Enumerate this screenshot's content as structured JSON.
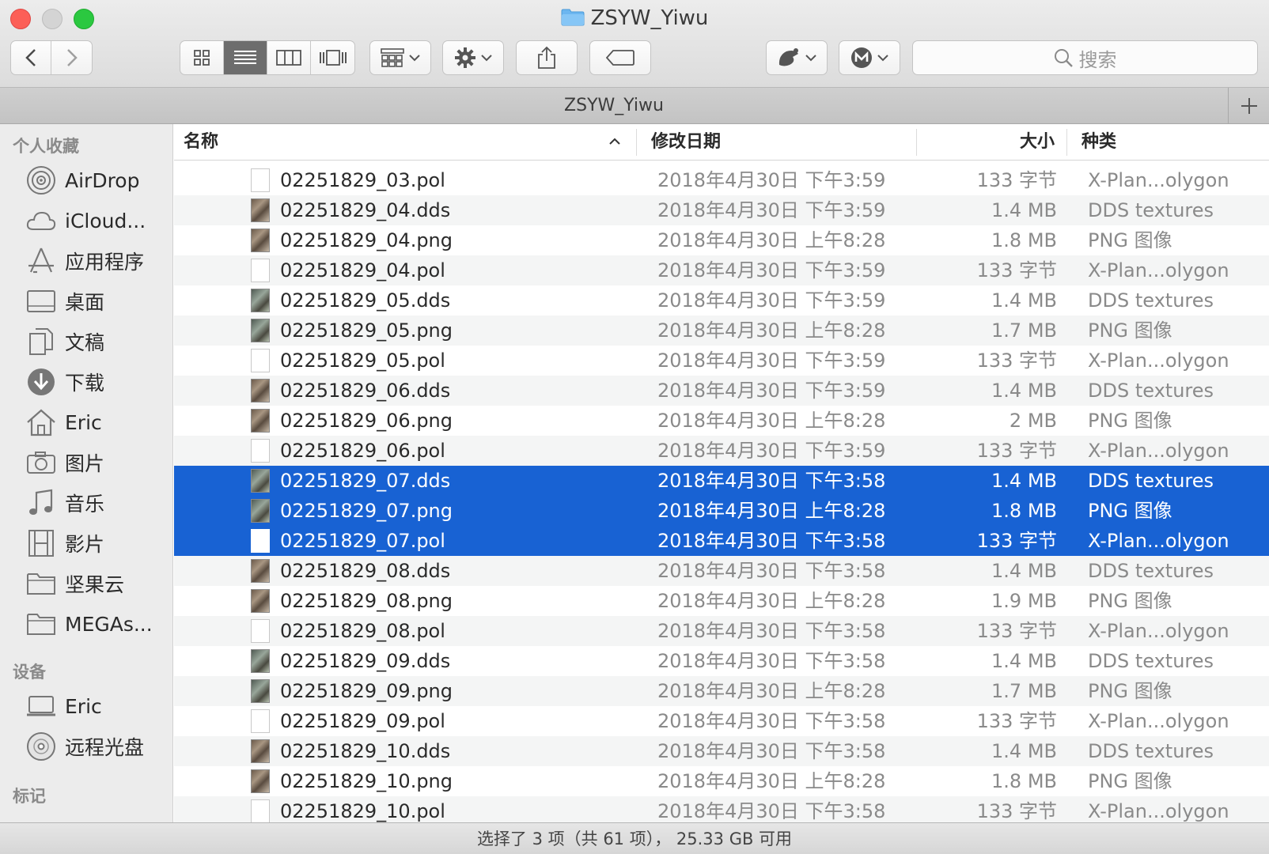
{
  "window": {
    "title": "ZSYW_Yiwu"
  },
  "toolbar": {
    "search_placeholder": "搜索",
    "icons": [
      "back-icon",
      "forward-icon",
      "icon-view-icon",
      "list-view-icon",
      "column-view-icon",
      "coverflow-view-icon",
      "arrange-icon",
      "gear-icon",
      "share-icon",
      "tag-icon",
      "app-extension-icon",
      "mega-icon",
      "search-icon"
    ]
  },
  "tab": {
    "title": "ZSYW_Yiwu"
  },
  "sidebar": {
    "favorites_header": "个人收藏",
    "favorites": [
      {
        "label": "AirDrop",
        "icon": "airdrop-icon"
      },
      {
        "label": "iCloud...",
        "icon": "icloud-icon"
      },
      {
        "label": "应用程序",
        "icon": "applications-icon"
      },
      {
        "label": "桌面",
        "icon": "desktop-icon"
      },
      {
        "label": "文稿",
        "icon": "documents-icon"
      },
      {
        "label": "下载",
        "icon": "downloads-icon"
      },
      {
        "label": "Eric",
        "icon": "home-icon"
      },
      {
        "label": "图片",
        "icon": "pictures-icon"
      },
      {
        "label": "音乐",
        "icon": "music-icon"
      },
      {
        "label": "影片",
        "icon": "movies-icon"
      },
      {
        "label": "坚果云",
        "icon": "folder-icon"
      },
      {
        "label": "MEGAs...",
        "icon": "folder-icon"
      }
    ],
    "devices_header": "设备",
    "devices": [
      {
        "label": "Eric",
        "icon": "computer-icon"
      },
      {
        "label": "远程光盘",
        "icon": "disc-icon"
      }
    ],
    "tags_header": "标记"
  },
  "columns": {
    "name": "名称",
    "date": "修改日期",
    "size": "大小",
    "kind": "种类"
  },
  "files": [
    {
      "name": "02251829_03.pol",
      "date": "2018年4月30日 下午3:59",
      "size": "133 字节",
      "kind": "X-Plan...olygon",
      "type": "doc",
      "selected": false
    },
    {
      "name": "02251829_04.dds",
      "date": "2018年4月30日 下午3:59",
      "size": "1.4 MB",
      "kind": "DDS textures",
      "type": "thumb",
      "selected": false
    },
    {
      "name": "02251829_04.png",
      "date": "2018年4月30日 上午8:28",
      "size": "1.8 MB",
      "kind": "PNG 图像",
      "type": "thumb",
      "selected": false
    },
    {
      "name": "02251829_04.pol",
      "date": "2018年4月30日 下午3:59",
      "size": "133 字节",
      "kind": "X-Plan...olygon",
      "type": "doc",
      "selected": false
    },
    {
      "name": "02251829_05.dds",
      "date": "2018年4月30日 下午3:59",
      "size": "1.4 MB",
      "kind": "DDS textures",
      "type": "thumb2",
      "selected": false
    },
    {
      "name": "02251829_05.png",
      "date": "2018年4月30日 上午8:28",
      "size": "1.7 MB",
      "kind": "PNG 图像",
      "type": "thumb2",
      "selected": false
    },
    {
      "name": "02251829_05.pol",
      "date": "2018年4月30日 下午3:59",
      "size": "133 字节",
      "kind": "X-Plan...olygon",
      "type": "doc",
      "selected": false
    },
    {
      "name": "02251829_06.dds",
      "date": "2018年4月30日 下午3:59",
      "size": "1.4 MB",
      "kind": "DDS textures",
      "type": "thumb",
      "selected": false
    },
    {
      "name": "02251829_06.png",
      "date": "2018年4月30日 上午8:28",
      "size": "2 MB",
      "kind": "PNG 图像",
      "type": "thumb",
      "selected": false
    },
    {
      "name": "02251829_06.pol",
      "date": "2018年4月30日 下午3:59",
      "size": "133 字节",
      "kind": "X-Plan...olygon",
      "type": "doc",
      "selected": false
    },
    {
      "name": "02251829_07.dds",
      "date": "2018年4月30日 下午3:58",
      "size": "1.4 MB",
      "kind": "DDS textures",
      "type": "thumb2",
      "selected": true
    },
    {
      "name": "02251829_07.png",
      "date": "2018年4月30日 上午8:28",
      "size": "1.8 MB",
      "kind": "PNG 图像",
      "type": "thumb2",
      "selected": true
    },
    {
      "name": "02251829_07.pol",
      "date": "2018年4月30日 下午3:58",
      "size": "133 字节",
      "kind": "X-Plan...olygon",
      "type": "doc",
      "selected": true
    },
    {
      "name": "02251829_08.dds",
      "date": "2018年4月30日 下午3:58",
      "size": "1.4 MB",
      "kind": "DDS textures",
      "type": "thumb",
      "selected": false
    },
    {
      "name": "02251829_08.png",
      "date": "2018年4月30日 上午8:28",
      "size": "1.9 MB",
      "kind": "PNG 图像",
      "type": "thumb",
      "selected": false
    },
    {
      "name": "02251829_08.pol",
      "date": "2018年4月30日 下午3:58",
      "size": "133 字节",
      "kind": "X-Plan...olygon",
      "type": "doc",
      "selected": false
    },
    {
      "name": "02251829_09.dds",
      "date": "2018年4月30日 下午3:58",
      "size": "1.4 MB",
      "kind": "DDS textures",
      "type": "thumb2",
      "selected": false
    },
    {
      "name": "02251829_09.png",
      "date": "2018年4月30日 上午8:28",
      "size": "1.7 MB",
      "kind": "PNG 图像",
      "type": "thumb2",
      "selected": false
    },
    {
      "name": "02251829_09.pol",
      "date": "2018年4月30日 下午3:58",
      "size": "133 字节",
      "kind": "X-Plan...olygon",
      "type": "doc",
      "selected": false
    },
    {
      "name": "02251829_10.dds",
      "date": "2018年4月30日 下午3:58",
      "size": "1.4 MB",
      "kind": "DDS textures",
      "type": "thumb",
      "selected": false
    },
    {
      "name": "02251829_10.png",
      "date": "2018年4月30日 上午8:28",
      "size": "1.8 MB",
      "kind": "PNG 图像",
      "type": "thumb",
      "selected": false
    },
    {
      "name": "02251829_10.pol",
      "date": "2018年4月30日 下午3:58",
      "size": "133 字节",
      "kind": "X-Plan...olygon",
      "type": "doc",
      "selected": false
    }
  ],
  "status": {
    "text": "选择了 3 项（共 61 项）， 25.33 GB 可用"
  },
  "colors": {
    "selection": "#1862d3",
    "close": "#fc5f57",
    "zoom": "#2bc840",
    "sidebar_bg": "#ececec"
  }
}
